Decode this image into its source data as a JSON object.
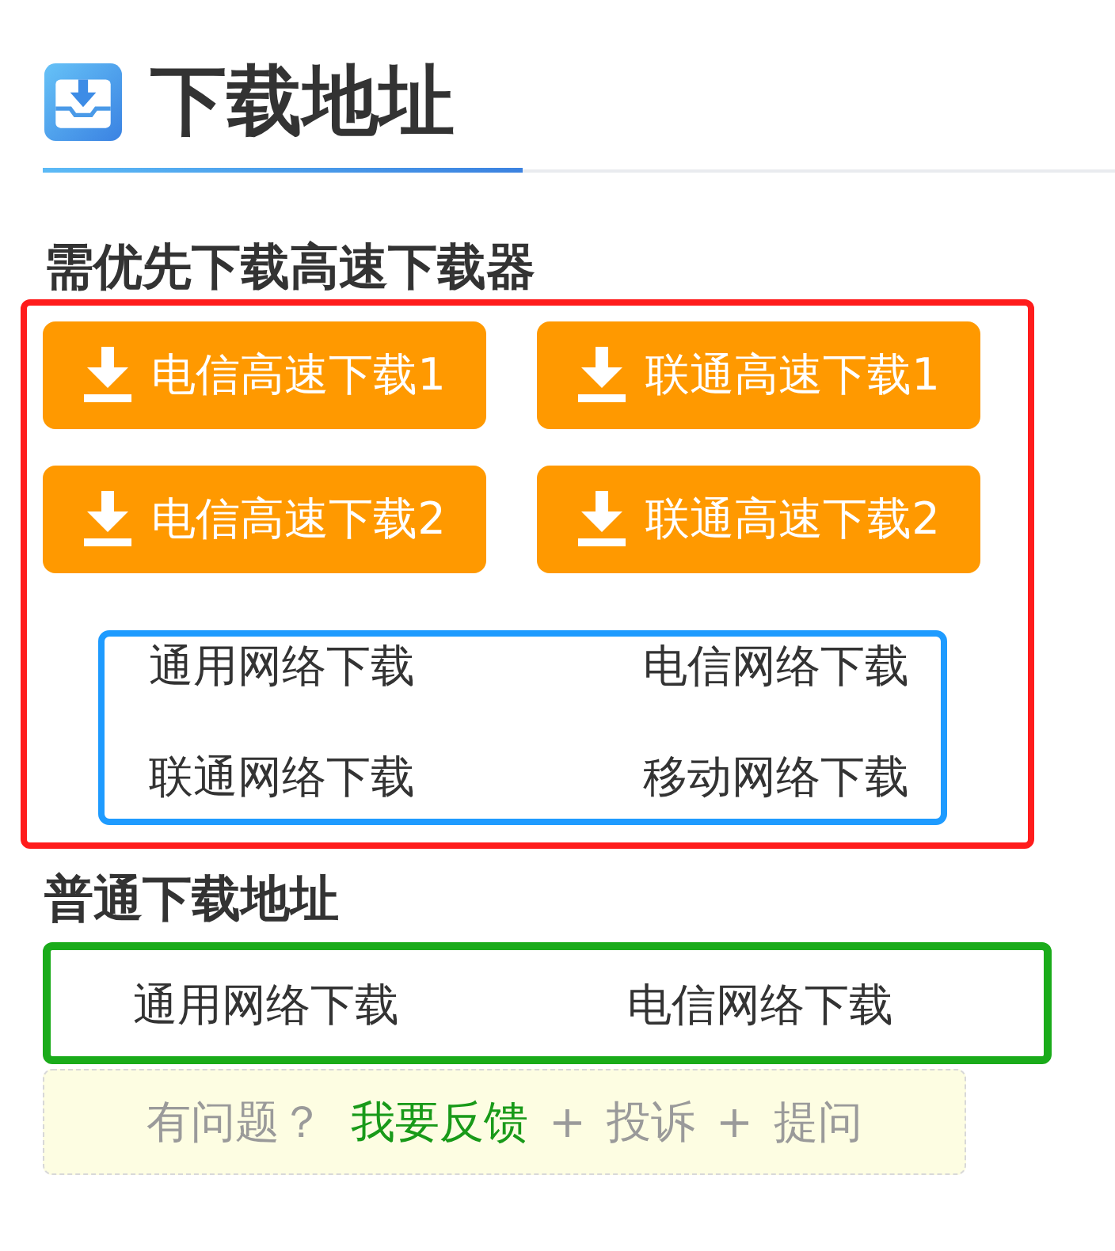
{
  "header": {
    "title": "下载地址"
  },
  "fast_section": {
    "heading": "需优先下载高速下载器",
    "buttons": [
      {
        "label": "电信高速下载1"
      },
      {
        "label": "联通高速下载1"
      },
      {
        "label": "电信高速下载2"
      },
      {
        "label": "联通高速下载2"
      }
    ],
    "links": [
      "通用网络下载",
      "电信网络下载",
      "联通网络下载",
      "移动网络下载"
    ]
  },
  "normal_section": {
    "heading": "普通下载地址",
    "links": [
      "通用网络下载",
      "电信网络下载"
    ]
  },
  "feedback": {
    "parts": [
      {
        "kind": "prompt",
        "text": "有问题？"
      },
      {
        "kind": "link",
        "text": "我要反馈"
      },
      {
        "kind": "sep",
        "text": "+"
      },
      {
        "kind": "option",
        "text": "投诉"
      },
      {
        "kind": "sep",
        "text": "+"
      },
      {
        "kind": "option",
        "text": "提问"
      }
    ]
  }
}
